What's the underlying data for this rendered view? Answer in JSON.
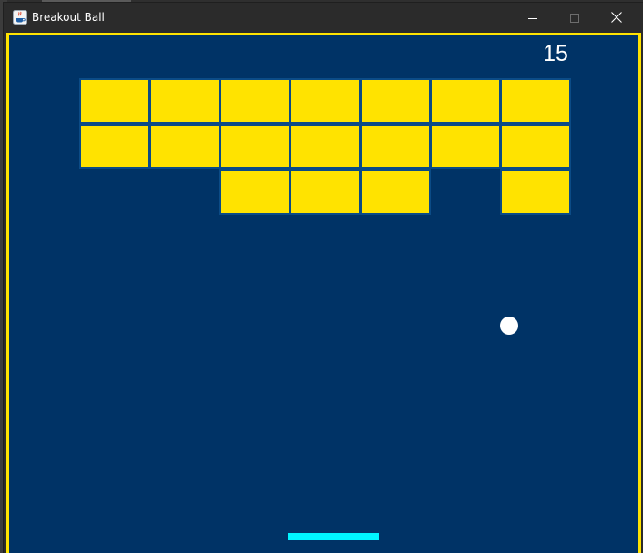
{
  "window": {
    "title": "Breakout Ball",
    "icons": {
      "app": "java-cup-icon",
      "minimize": "minimize-icon",
      "maximize": "maximize-icon",
      "close": "close-icon"
    }
  },
  "game": {
    "score": "15",
    "colors": {
      "background": "#003366",
      "border": "#ffe300",
      "brick": "#ffe300",
      "brick_outline": "#0b4b86",
      "ball": "#ffffff",
      "paddle": "#00f5ff",
      "score_text": "#ffffff"
    },
    "brick_grid": {
      "rows": 3,
      "cols": 7,
      "present": [
        [
          true,
          true,
          true,
          true,
          true,
          true,
          true
        ],
        [
          true,
          true,
          true,
          true,
          true,
          true,
          true
        ],
        [
          false,
          false,
          true,
          true,
          true,
          false,
          true
        ]
      ]
    }
  }
}
